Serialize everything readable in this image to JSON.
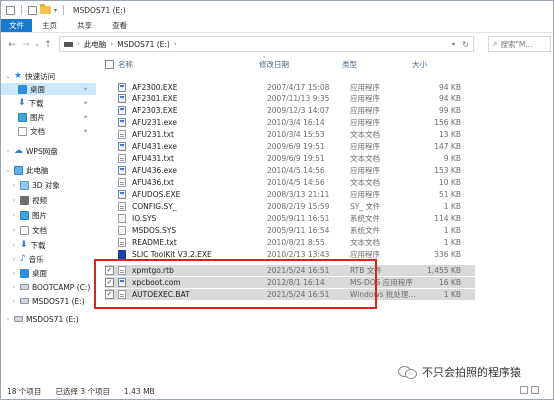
{
  "window": {
    "title": "MSDOS71 (E:)"
  },
  "ribbon": {
    "tabs": [
      "文件",
      "主页",
      "共享",
      "查看"
    ]
  },
  "address": {
    "crumbs": [
      "此电脑",
      "MSDOS71 (E:)"
    ]
  },
  "search": {
    "placeholder": "搜索\"M..."
  },
  "sidebar": {
    "items": [
      {
        "label": "快速访问",
        "icon": "star-icon"
      },
      {
        "label": "桌面",
        "icon": "desktop-icon",
        "pinned": true,
        "selected": true
      },
      {
        "label": "下载",
        "icon": "download-icon",
        "pinned": true
      },
      {
        "label": "图片",
        "icon": "pictures-icon",
        "pinned": true
      },
      {
        "label": "文档",
        "icon": "documents-icon",
        "pinned": true
      },
      {
        "label": "WPS网盘",
        "icon": "cloud-icon"
      },
      {
        "label": "此电脑",
        "icon": "computer-icon"
      },
      {
        "label": "3D 对象",
        "icon": "3d-objects-icon"
      },
      {
        "label": "视频",
        "icon": "videos-icon"
      },
      {
        "label": "图片",
        "icon": "pictures-icon"
      },
      {
        "label": "文档",
        "icon": "documents-icon"
      },
      {
        "label": "下载",
        "icon": "download-icon"
      },
      {
        "label": "音乐",
        "icon": "music-icon"
      },
      {
        "label": "桌面",
        "icon": "desktop-icon"
      },
      {
        "label": "BOOTCAMP (C:)",
        "icon": "drive-icon"
      },
      {
        "label": "MSDOS71 (E:)",
        "icon": "drive-icon"
      },
      {
        "label": "MSDOS71 (E:)",
        "icon": "drive-icon"
      }
    ]
  },
  "columns": {
    "name": "名称",
    "date": "修改日期",
    "type": "类型",
    "size": "大小"
  },
  "files": [
    {
      "name": "AF2300.EXE",
      "date": "2007/4/17 15:08",
      "type": "应用程序",
      "size": "94 KB",
      "kind": "exe"
    },
    {
      "name": "AF2301.EXE",
      "date": "2007/11/13 9:35",
      "type": "应用程序",
      "size": "94 KB",
      "kind": "exe"
    },
    {
      "name": "AF2303.EXE",
      "date": "2009/12/3 14:07",
      "type": "应用程序",
      "size": "99 KB",
      "kind": "exe"
    },
    {
      "name": "AFU231.exe",
      "date": "2010/3/4 16:14",
      "type": "应用程序",
      "size": "156 KB",
      "kind": "exe"
    },
    {
      "name": "AFU231.txt",
      "date": "2010/3/4 15:53",
      "type": "文本文档",
      "size": "13 KB",
      "kind": "txt"
    },
    {
      "name": "AFU431.exe",
      "date": "2009/6/9 19:51",
      "type": "应用程序",
      "size": "147 KB",
      "kind": "exe"
    },
    {
      "name": "AFU431.txt",
      "date": "2009/6/9 19:51",
      "type": "文本文档",
      "size": "9 KB",
      "kind": "txt"
    },
    {
      "name": "AFU436.exe",
      "date": "2010/4/5 14:56",
      "type": "应用程序",
      "size": "153 KB",
      "kind": "exe"
    },
    {
      "name": "AFU436.txt",
      "date": "2010/4/5 14:56",
      "type": "文本文档",
      "size": "10 KB",
      "kind": "txt"
    },
    {
      "name": "AFUDOS.EXE",
      "date": "2008/3/13 21:11",
      "type": "应用程序",
      "size": "51 KB",
      "kind": "exe"
    },
    {
      "name": "CONFIG.SY_",
      "date": "2008/2/19 15:59",
      "type": "SY_ 文件",
      "size": "1 KB",
      "kind": "txt"
    },
    {
      "name": "IO.SYS",
      "date": "2005/9/11 16:51",
      "type": "系统文件",
      "size": "114 KB",
      "kind": "sys"
    },
    {
      "name": "MSDOS.SYS",
      "date": "2005/9/11 16:54",
      "type": "系统文件",
      "size": "1 KB",
      "kind": "sys"
    },
    {
      "name": "README.txt",
      "date": "2010/8/21 8:55",
      "type": "文本文档",
      "size": "1 KB",
      "kind": "txt"
    },
    {
      "name": "SLIC ToolKit V3.2.EXE",
      "date": "2010/2/13 13:43",
      "type": "应用程序",
      "size": "336 KB",
      "kind": "slic"
    },
    {
      "name": "xpmtgo.rtb",
      "date": "2021/5/24 16:51",
      "type": "RTB 文件",
      "size": "1,455 KB",
      "kind": "txt",
      "selected": true
    },
    {
      "name": "xpcboot.com",
      "date": "2012/8/1 16:14",
      "type": "MS-DOS 应用程序",
      "size": "16 KB",
      "kind": "exe",
      "selected": true
    },
    {
      "name": "AUTOEXEC.BAT",
      "date": "2021/5/24 16:51",
      "type": "Windows 批处理...",
      "size": "1 KB",
      "kind": "txt",
      "selected": true
    }
  ],
  "status": {
    "count": "18 个项目",
    "selected": "已选择 3 个项目",
    "size": "1.43 MB"
  },
  "watermark": {
    "text": "不只会拍照的程序猿"
  }
}
